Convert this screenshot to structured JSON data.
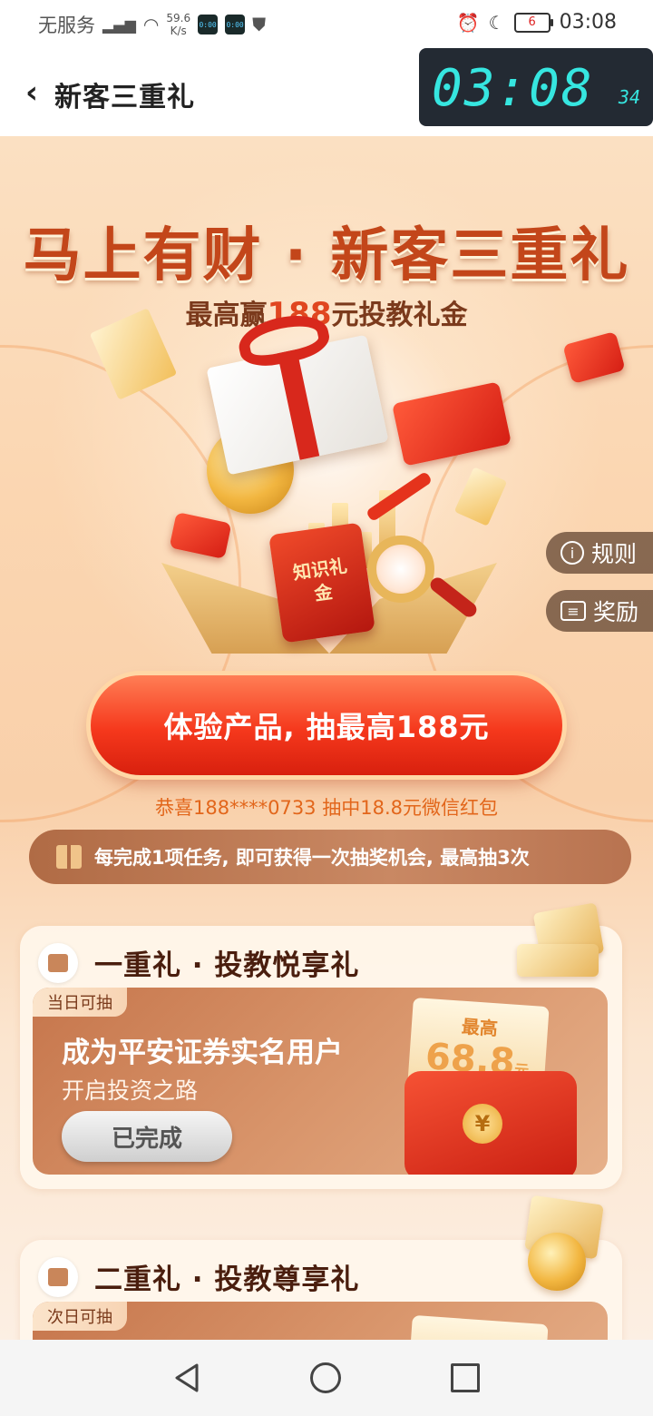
{
  "status_bar": {
    "carrier": "无服务",
    "net_speed_value": "59.6",
    "net_speed_unit": "K/s",
    "app_icon_text": "0:00",
    "battery": "6",
    "time": "03:08"
  },
  "header": {
    "title": "新客三重礼",
    "clock_main": "03:08",
    "clock_seconds": "34"
  },
  "hero": {
    "headline": "马上有财 · 新客三重礼",
    "sub_prefix": "最高赢",
    "sub_amount": "188",
    "sub_suffix": "元投教礼金",
    "packet_label": "知识礼金"
  },
  "side_buttons": {
    "rules": "规则",
    "rewards": "奖励"
  },
  "cta": {
    "label": "体验产品, 抽最高188元",
    "winner_text": "恭喜188****0733 抽中18.8元微信红包"
  },
  "notice": "每完成1项任务, 即可获得一次抽奖机会, 最高抽3次",
  "cards": [
    {
      "title": "一重礼 · 投教悦享礼",
      "tag": "当日可抽",
      "task_title": "成为平安证券实名用户",
      "task_sub": "开启投资之路",
      "button": "已完成",
      "prize_label": "最高",
      "prize_value": "68.8",
      "prize_unit": "元",
      "yen": "¥"
    },
    {
      "title": "二重礼 · 投教尊享礼",
      "tag": "次日可抽"
    }
  ]
}
